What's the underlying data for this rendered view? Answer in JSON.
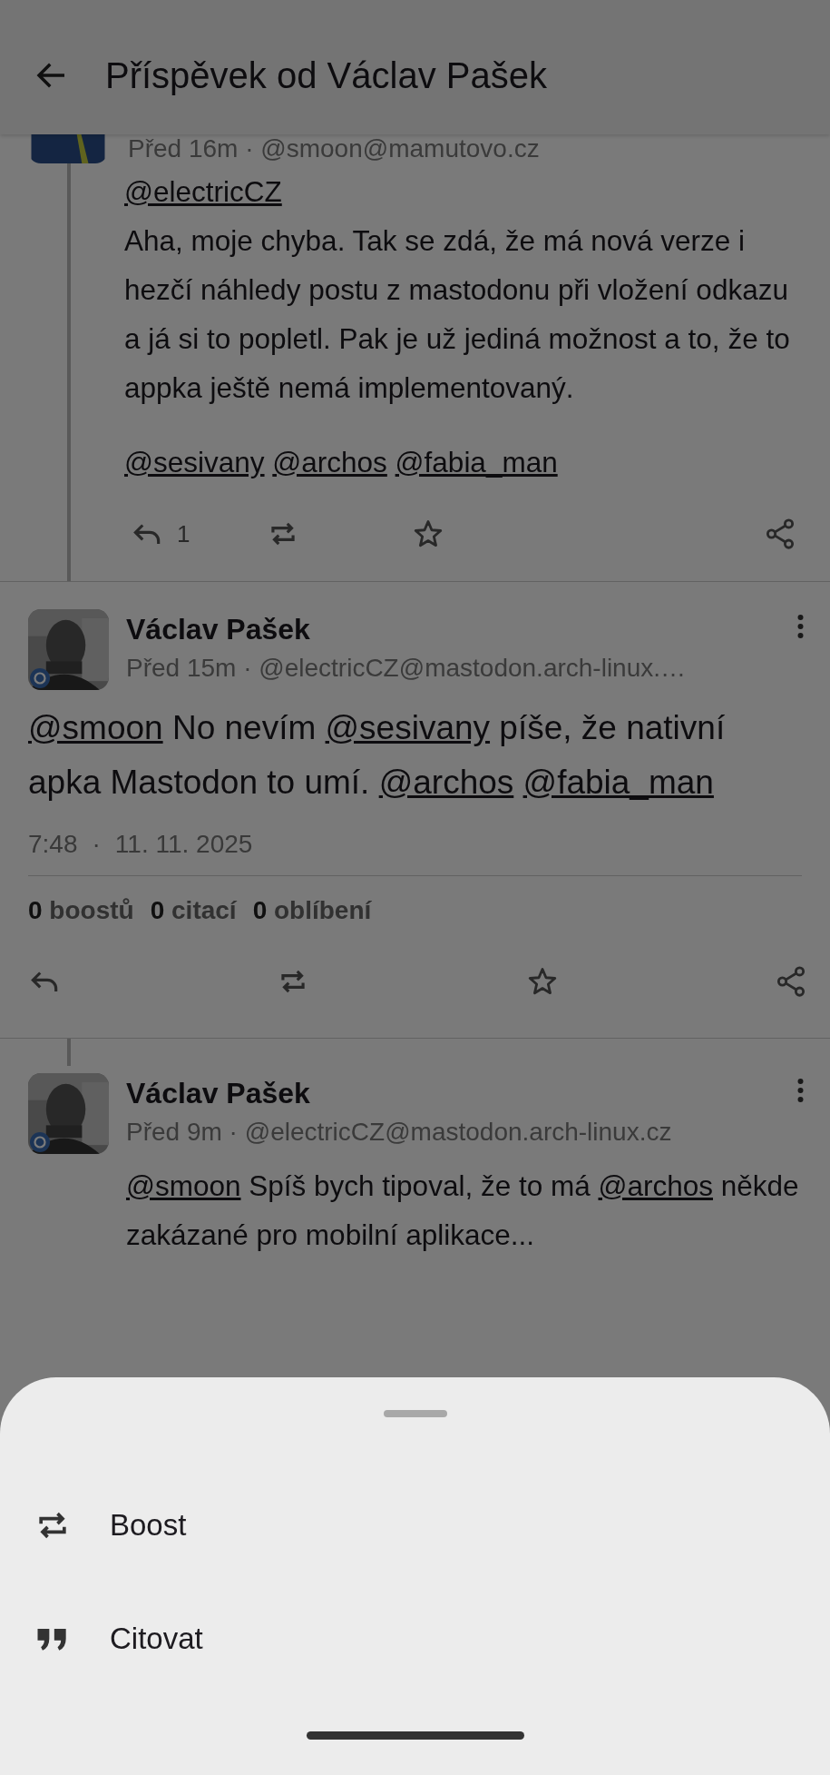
{
  "app_bar": {
    "title": "Příspěvek od Václav Pašek"
  },
  "posts": [
    {
      "kind": "ancestor",
      "meta": "Před 16m · @smoon@mamutovo.cz",
      "body": [
        {
          "kind": "mention",
          "text": "@electricCZ"
        },
        {
          "kind": "break"
        },
        {
          "kind": "text",
          "text": "Aha, moje chyba. Tak se zdá, že má nová verze i hezčí náhledy postu z mastodonu při vložení odkazu a já si to popletl. Pak je už jediná možnost a to, že to appka ještě nemá implementovaný."
        },
        {
          "kind": "paragraph"
        },
        {
          "kind": "mention",
          "text": "@sesivany"
        },
        {
          "kind": "space"
        },
        {
          "kind": "mention",
          "text": "@archos"
        },
        {
          "kind": "space"
        },
        {
          "kind": "mention",
          "text": "@fabia_man"
        }
      ],
      "actions": [
        {
          "kind": "reply",
          "count": "1"
        },
        {
          "kind": "boost"
        },
        {
          "kind": "favourite"
        },
        {
          "kind": "share"
        }
      ]
    },
    {
      "kind": "focused",
      "name": "Václav Pašek",
      "meta": "Před 15m · @electricCZ@mastodon.arch-linux.…",
      "body": [
        {
          "kind": "mention",
          "text": "@smoon"
        },
        {
          "kind": "text",
          "text": " No nevím "
        },
        {
          "kind": "mention",
          "text": "@sesivany"
        },
        {
          "kind": "text",
          "text": " píše, že nativní apka Mastodon to umí. "
        },
        {
          "kind": "mention",
          "text": "@archos"
        },
        {
          "kind": "space"
        },
        {
          "kind": "mention",
          "text": "@fabia_man"
        }
      ],
      "time": "7:48",
      "separator": "·",
      "date": "11. 11. 2025",
      "stats": [
        {
          "count": "0",
          "label": "boostů"
        },
        {
          "count": "0",
          "label": "citací"
        },
        {
          "count": "0",
          "label": "oblíbení"
        }
      ],
      "actions": [
        {
          "kind": "reply"
        },
        {
          "kind": "boost"
        },
        {
          "kind": "favourite"
        },
        {
          "kind": "share"
        }
      ]
    },
    {
      "kind": "descendant",
      "name": "Václav Pašek",
      "meta": "Před 9m · @electricCZ@mastodon.arch-linux.cz",
      "body": [
        {
          "kind": "mention",
          "text": "@smoon"
        },
        {
          "kind": "text",
          "text": " Spíš bych tipoval, že to má "
        },
        {
          "kind": "mention",
          "text": "@archos"
        },
        {
          "kind": "text",
          "text": " někde zakázané pro mobilní aplikace..."
        }
      ]
    }
  ],
  "sheet": {
    "items": [
      {
        "kind": "boost",
        "label": "Boost"
      },
      {
        "kind": "quote",
        "label": "Citovat"
      }
    ]
  }
}
